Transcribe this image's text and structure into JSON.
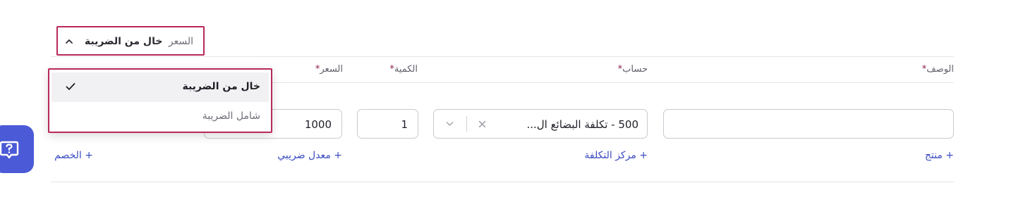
{
  "price_toggle": {
    "label": "السعر",
    "value": "خال من الضريبة"
  },
  "columns": {
    "description": "الوصف",
    "account": "حساب",
    "quantity": "الكمية",
    "price": "السعر",
    "required_mark": "*"
  },
  "row": {
    "description_value": "",
    "account_value": "500 - تكلفة البضائع ال...",
    "quantity_value": "1",
    "price_value": "1000"
  },
  "links": {
    "add_product": "+ منتج",
    "add_cost_center": "+ مركز التكلفة",
    "add_tax_rate": "+ معدل ضريبي",
    "add_discount": "+ الخصم"
  },
  "tax_menu": {
    "options": [
      {
        "label": "خال من الضريبة",
        "selected": true
      },
      {
        "label": "شامل الضريبة",
        "selected": false
      }
    ]
  },
  "icons": {
    "toggle": "chevron-up-icon",
    "select_clear": "close-icon",
    "select_open": "chevron-down-icon",
    "selected_option": "check-icon",
    "help": "help-chat-icon"
  },
  "colors": {
    "highlight": "#b8295a",
    "link": "#3a4cc2",
    "required": "#8b1f4e",
    "help_button": "#4b5ad6"
  }
}
